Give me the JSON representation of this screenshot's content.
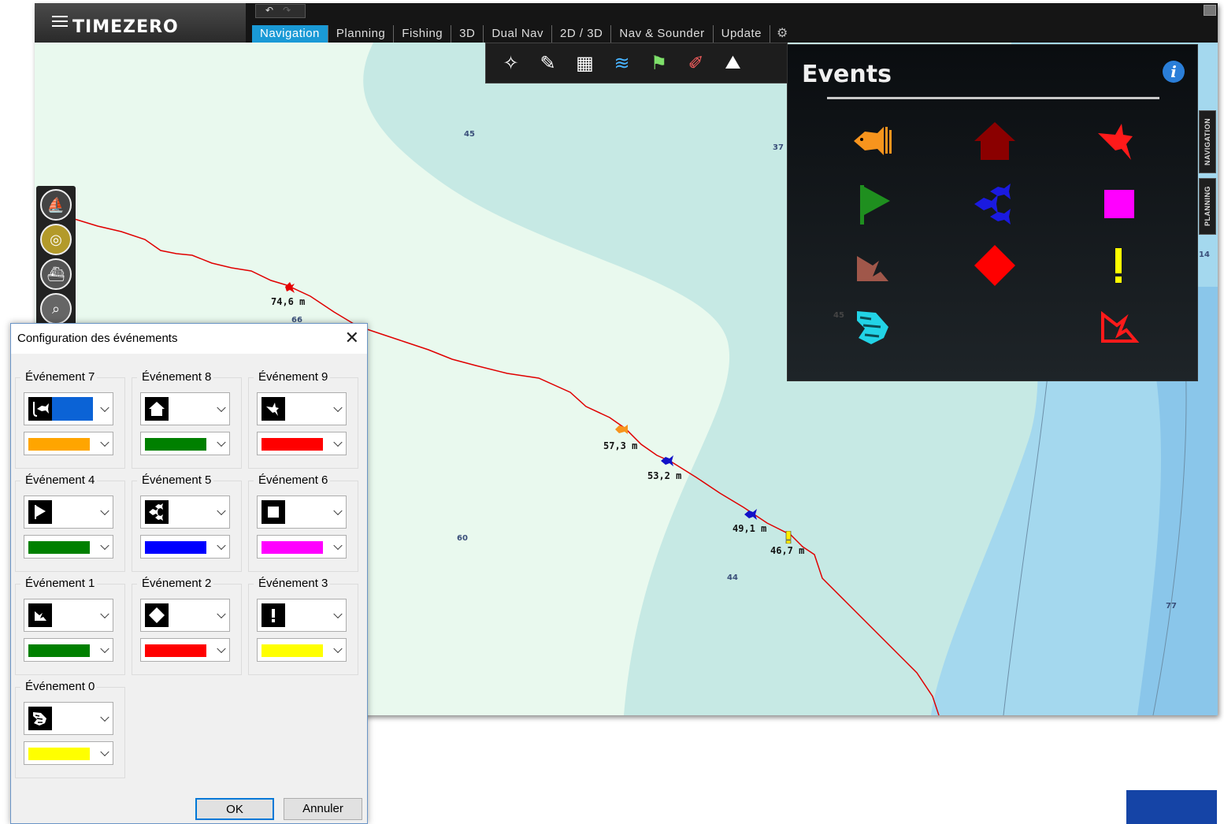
{
  "app": {
    "title": "TIMEZERO",
    "undo_label": "↶",
    "redo_label": "↷",
    "tabs": [
      {
        "label": "Navigation",
        "active": true
      },
      {
        "label": "Planning",
        "active": false
      },
      {
        "label": "Fishing",
        "active": false
      },
      {
        "label": "3D",
        "active": false
      },
      {
        "label": "Dual Nav",
        "active": false
      },
      {
        "label": "2D / 3D",
        "active": false
      },
      {
        "label": "Nav & Sounder",
        "active": false
      },
      {
        "label": "Update",
        "active": false
      }
    ],
    "ribbon_tools": [
      "compass-icon",
      "route-planner-icon",
      "chart-layer-icon",
      "sounder-icon",
      "waypoint-icon",
      "tide-icon",
      "mark-icon"
    ],
    "left_tools": [
      "boat-view-icon",
      "ownship-icon",
      "boat-3d-icon",
      "search-icon"
    ]
  },
  "events_panel": {
    "title": "Events",
    "info_label": "i",
    "icons": [
      {
        "name": "fish-school-orange-icon",
        "color": "#f7941d"
      },
      {
        "name": "home-dark-red-icon",
        "color": "#8b0000"
      },
      {
        "name": "swordfish-red-icon",
        "color": "#ff1a1a"
      },
      {
        "name": "flag-green-icon",
        "color": "#1f8f1f"
      },
      {
        "name": "fish-blue-icon",
        "color": "#1a1ae0"
      },
      {
        "name": "square-magenta-icon",
        "color": "#ff00ff"
      },
      {
        "name": "seabed-brown-icon",
        "color": "#a0574a"
      },
      {
        "name": "diamond-red-icon",
        "color": "#ff0000"
      },
      {
        "name": "exclamation-yellow-icon",
        "color": "#ffff00"
      },
      {
        "name": "wreck-cyan-icon",
        "color": "#22d3e6"
      },
      {
        "name": "seabed-red-icon",
        "color": "#ff1a1a"
      }
    ]
  },
  "side_tabs": {
    "navigation": "NAVIGATION",
    "planning": "PLANNING"
  },
  "chart": {
    "depths": [
      "45",
      "37",
      "66",
      "60",
      "44",
      "45",
      "14",
      "77"
    ],
    "track_labels": [
      "74,6 m",
      "57,3 m",
      "53,2 m",
      "49,1 m",
      "46,7 m"
    ]
  },
  "dialog": {
    "title": "Configuration des événements",
    "close_label": "✕",
    "events": [
      {
        "label": "Événement 7",
        "icon": "fish-hook-icon",
        "color": "#ffa500",
        "selected": true
      },
      {
        "label": "Événement 8",
        "icon": "home-icon",
        "color": "#008000"
      },
      {
        "label": "Événement 9",
        "icon": "swordfish-icon",
        "color": "#ff0000"
      },
      {
        "label": "Événement 4",
        "icon": "flag-icon",
        "color": "#008000"
      },
      {
        "label": "Événement 5",
        "icon": "fish-school-icon",
        "color": "#0000ff"
      },
      {
        "label": "Événement 6",
        "icon": "square-icon",
        "color": "#ff00ff"
      },
      {
        "label": "Événement 1",
        "icon": "seabed-icon",
        "color": "#008000"
      },
      {
        "label": "Événement 2",
        "icon": "diamond-icon",
        "color": "#ff0000"
      },
      {
        "label": "Événement 3",
        "icon": "exclamation-icon",
        "color": "#ffff00"
      },
      {
        "label": "Événement 0",
        "icon": "wreck-icon",
        "color": "#ffff00"
      }
    ],
    "ok_label": "OK",
    "cancel_label": "Annuler"
  }
}
